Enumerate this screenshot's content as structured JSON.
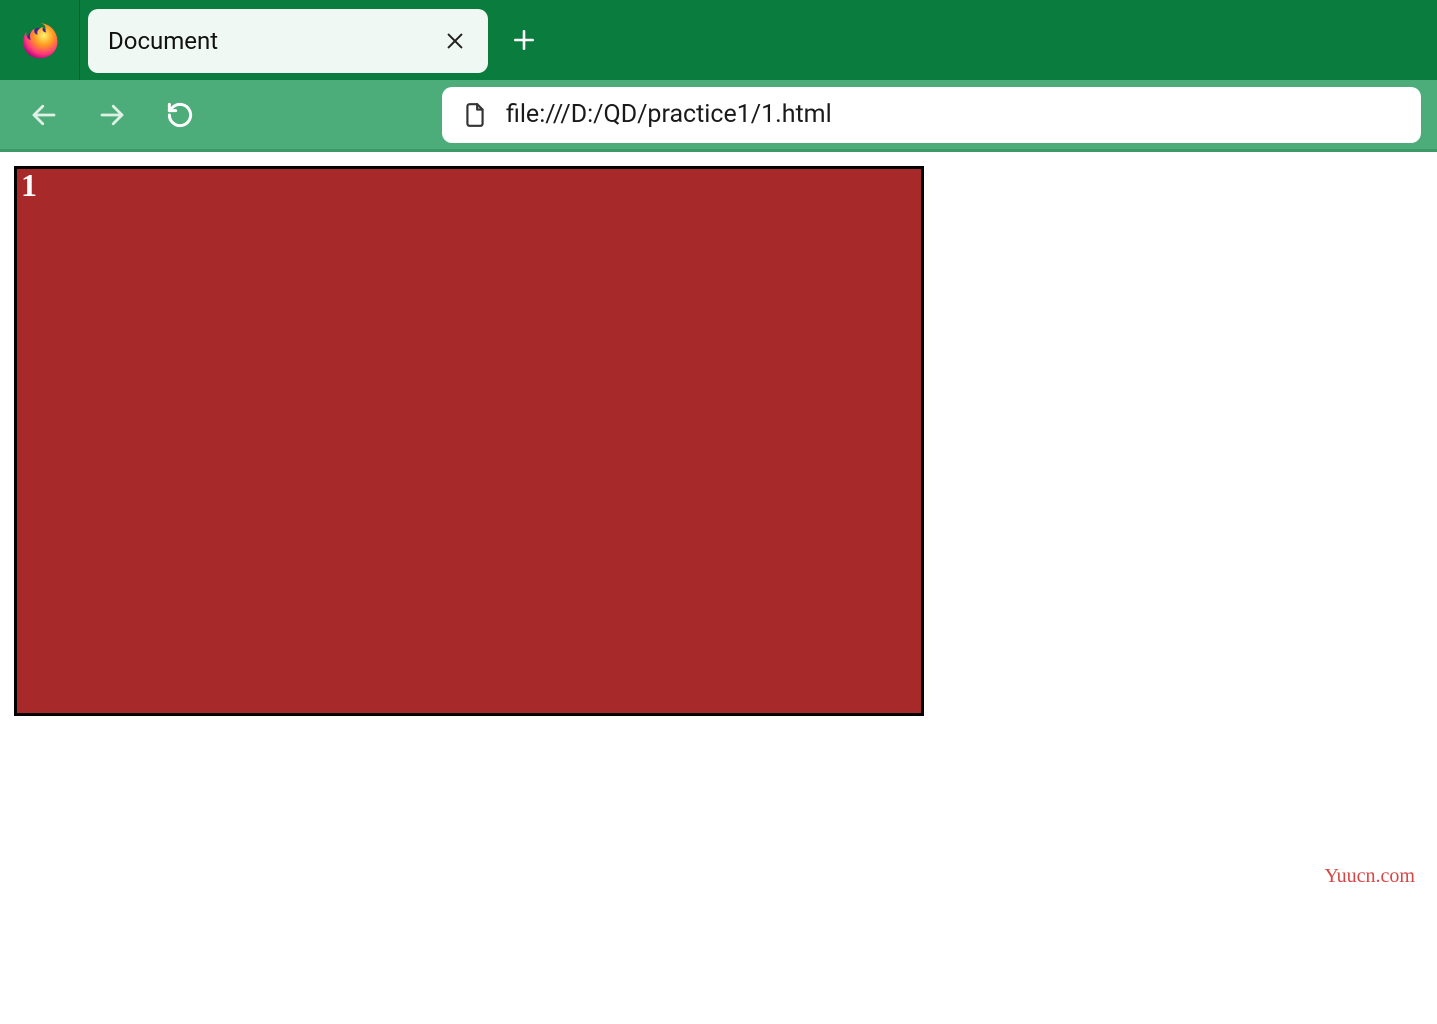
{
  "colors": {
    "titlebar": "#0a7c3e",
    "toolbar": "#4cad7a",
    "box_bg": "#a82929"
  },
  "tab": {
    "title": "Document"
  },
  "urlbar": {
    "value": "file:///D:/QD/practice1/1.html"
  },
  "page": {
    "box_text": "1"
  },
  "watermark": "Yuucn.com"
}
